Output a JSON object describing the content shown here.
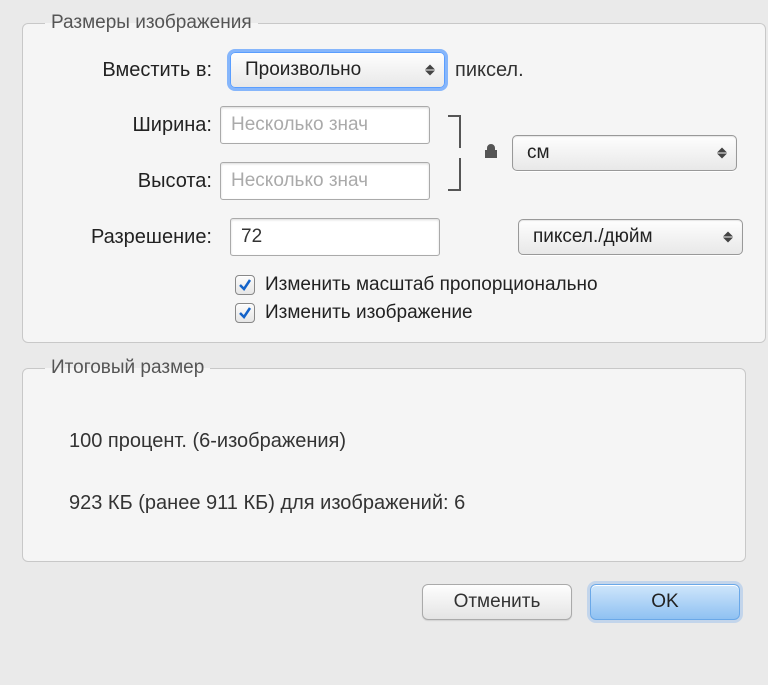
{
  "section_dimensions": {
    "legend": "Размеры изображения",
    "fit_label": "Вместить в:",
    "fit_select": "Произвольно",
    "fit_unit": "пиксел.",
    "width_label": "Ширина:",
    "width_placeholder": "Несколько знач",
    "height_label": "Высота:",
    "height_placeholder": "Несколько знач",
    "unit_select": "см",
    "resolution_label": "Разрешение:",
    "resolution_value": "72",
    "resolution_unit_select": "пиксел./дюйм",
    "scale_checkbox_label": "Изменить масштаб пропорционально",
    "resample_checkbox_label": "Изменить изображение",
    "scale_checked": true,
    "resample_checked": true
  },
  "section_result": {
    "legend": "Итоговый размер",
    "line1": "100 процент. (6-изображения)",
    "line2": "923 КБ (ранее 911 КБ) для изображений: 6"
  },
  "buttons": {
    "cancel": "Отменить",
    "ok": "OK"
  },
  "colors": {
    "focus": "#5a9eff",
    "check": "#1463c9"
  }
}
